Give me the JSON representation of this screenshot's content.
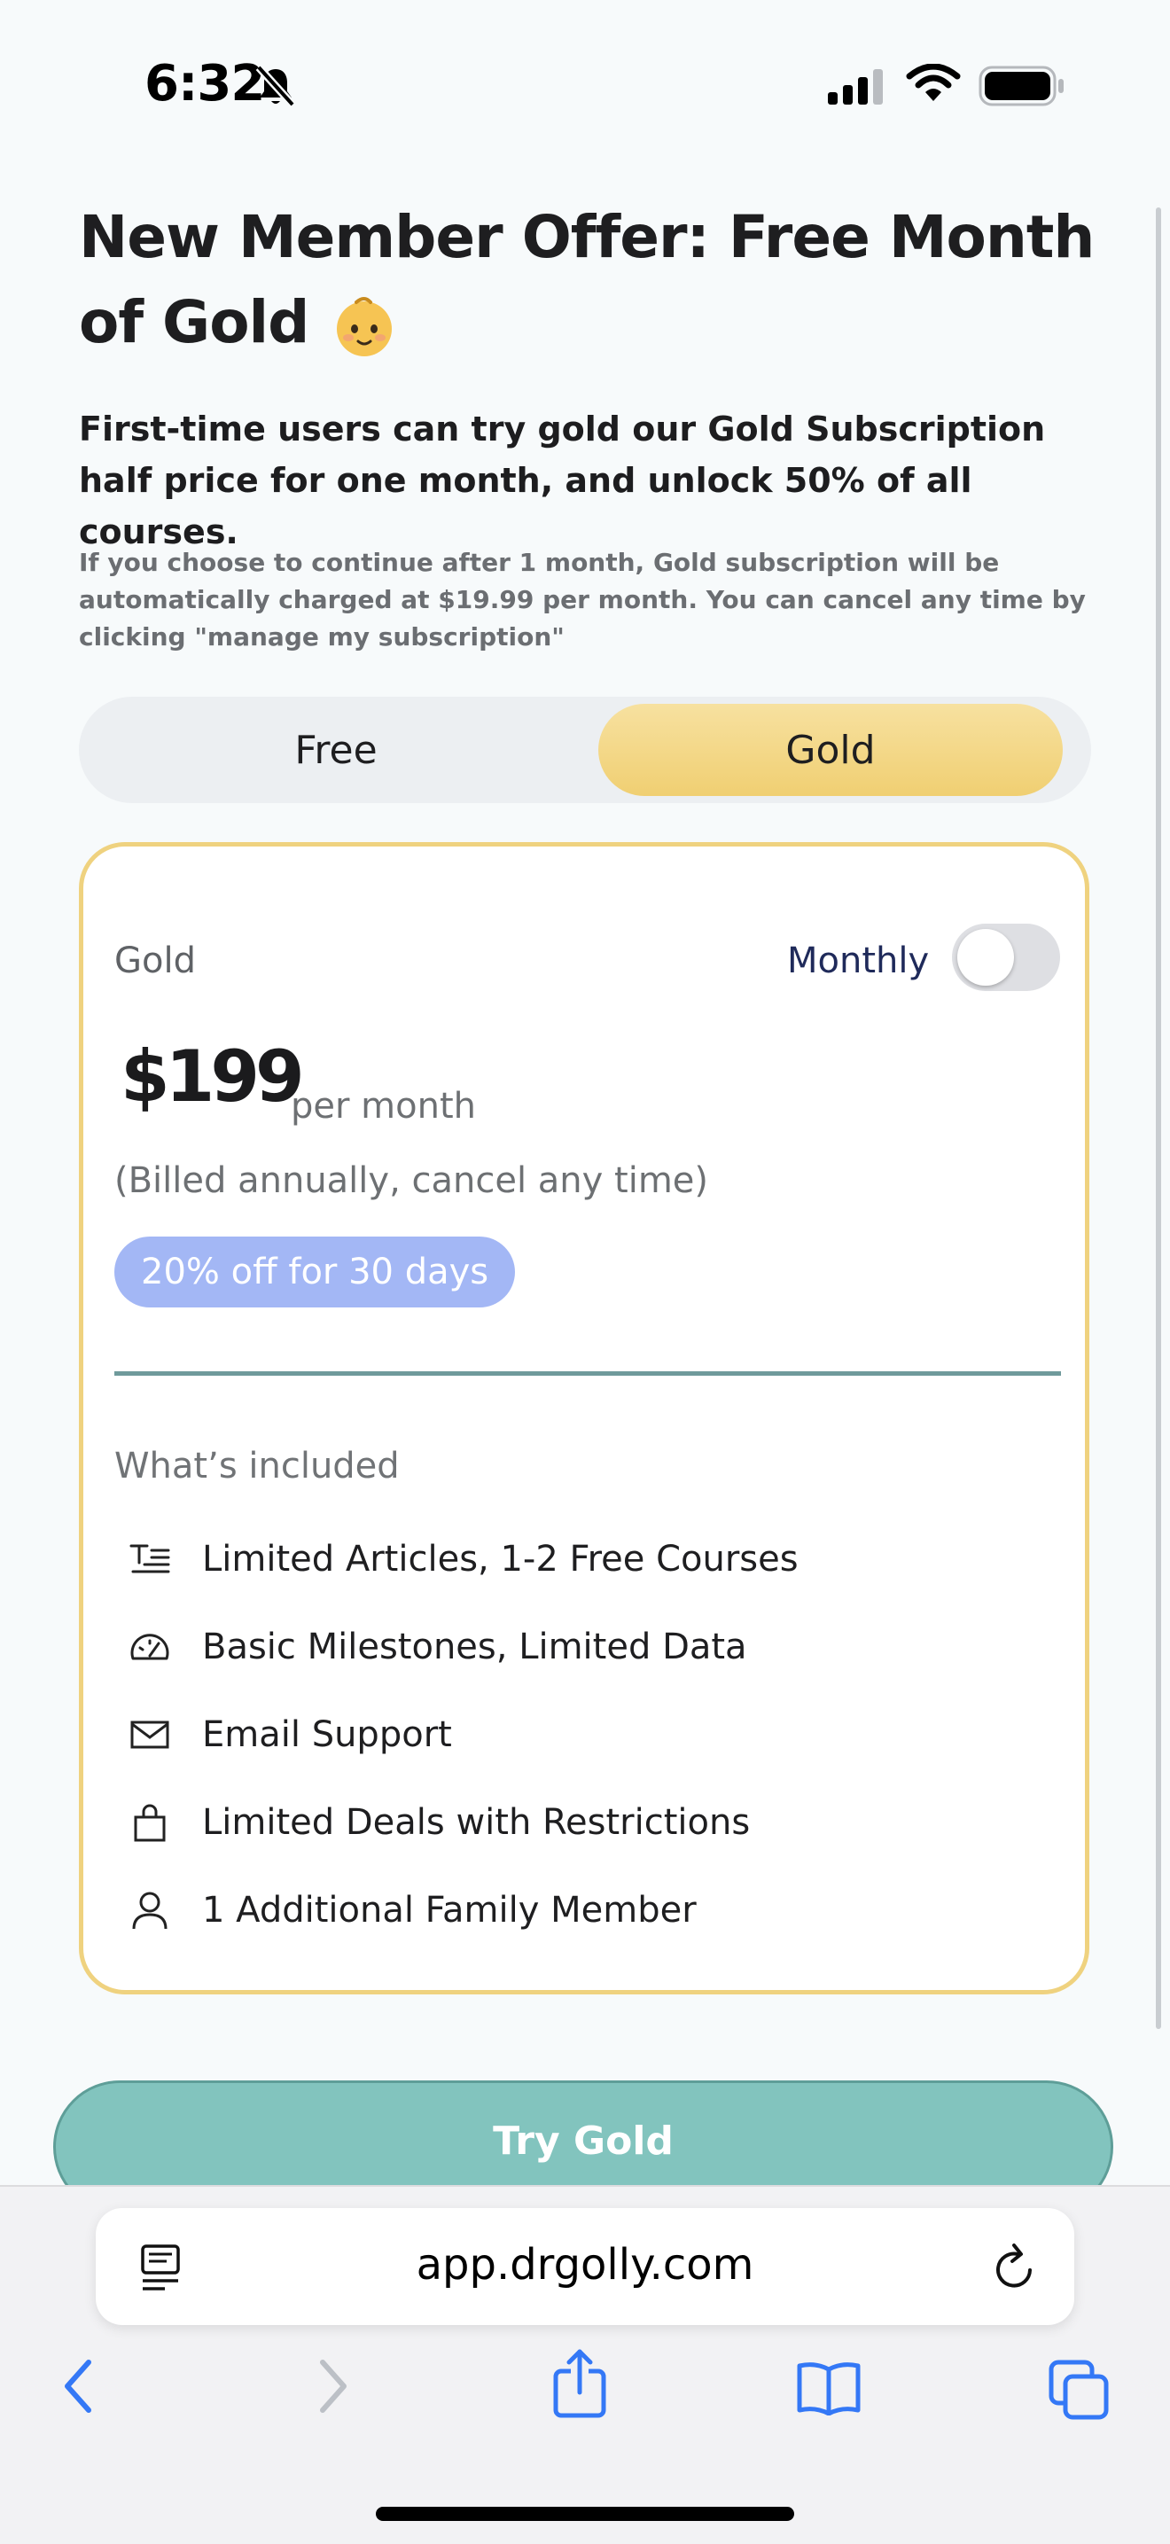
{
  "status_bar": {
    "time": "6:32"
  },
  "page": {
    "title": "New Member Offer: Free Month of Gold",
    "subtitle": "First-time users can try gold our Gold Subscription half price for one month, and unlock 50% of all courses.",
    "fine_print": "If you choose to continue after 1 month, Gold subscription will be automatically charged at $19.99 per month. You can cancel any time by clicking \"manage my subscription\""
  },
  "plan_toggle": {
    "options": [
      "Free",
      "Gold"
    ],
    "selected": "Gold"
  },
  "card": {
    "plan_label": "Gold",
    "billing_label": "Monthly",
    "billing_toggle_on": false,
    "price": "$199",
    "price_unit": "per month",
    "billing_note": "(Billed annually, cancel any time)",
    "promo_badge": "20% off for 30 days",
    "included_title": "What’s included",
    "features": [
      {
        "label": "Limited Articles, 1-2 Free Courses",
        "icon": "article-icon"
      },
      {
        "label": "Basic Milestones, Limited Data",
        "icon": "gauge-icon"
      },
      {
        "label": "Email Support",
        "icon": "mail-icon"
      },
      {
        "label": "Limited Deals with Restrictions",
        "icon": "shopping-bag-icon"
      },
      {
        "label": "1 Additional Family Member",
        "icon": "person-icon"
      }
    ]
  },
  "cta": {
    "label": "Try Gold"
  },
  "browser": {
    "url": "app.drgolly.com"
  },
  "colors": {
    "gold": "#f0cf72",
    "teal": "#82c4be",
    "promo": "#a3b7f5",
    "ios_blue": "#3478f6"
  }
}
